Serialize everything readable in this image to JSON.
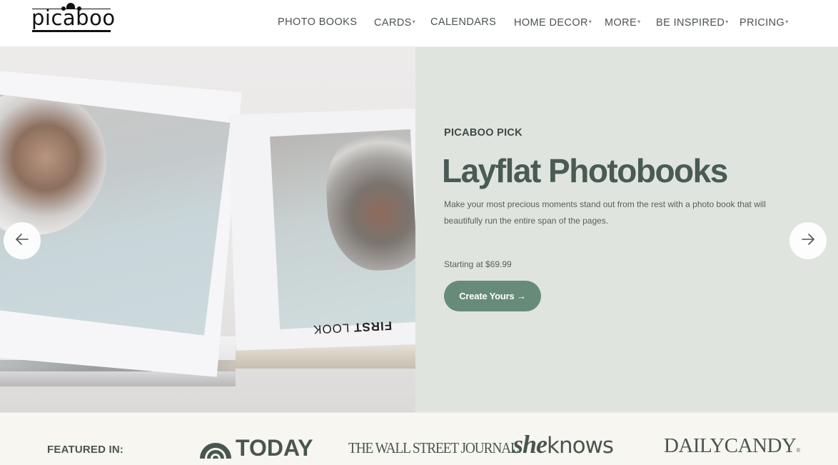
{
  "header": {
    "logo_text": "picaboo",
    "nav": [
      {
        "label": "PHOTO BOOKS",
        "has_dropdown": false
      },
      {
        "label": "CARDS",
        "has_dropdown": true
      },
      {
        "label": "CALENDARS",
        "has_dropdown": false
      },
      {
        "label": "HOME DECOR",
        "has_dropdown": true
      },
      {
        "label": "MORE",
        "has_dropdown": true
      },
      {
        "label": "BE INSPIRED",
        "has_dropdown": true
      },
      {
        "label": "PRICING",
        "has_dropdown": true
      }
    ],
    "caret_glyph": "▾"
  },
  "hero": {
    "image_caption_text_bold": "FIRST",
    "image_caption_text": " LOOK",
    "eyebrow": "PICABOO PICK",
    "title": "Layflat Photobooks",
    "description": "Make your most precious moments stand out from the rest with a photo book that will beautifully run the entire span of the pages.",
    "price": "Starting at $69.99",
    "cta_label": "Create Yours →",
    "prev_icon": "arrow-left-icon",
    "next_icon": "arrow-right-icon",
    "colors": {
      "panel_bg": "#dfe4de",
      "headline": "#4a5a54",
      "cta_bg": "#678b79"
    }
  },
  "featured": {
    "label": "FEATURED IN:",
    "logos": {
      "today": "TODAY",
      "wsj": "THE WALL STREET JOURNAL.",
      "sheknows_she": "she",
      "sheknows_knows": "knows",
      "dailycandy": "DAILYCANDY",
      "dailycandy_mark": "®"
    },
    "colors": {
      "bar_bg": "#f8f6f0",
      "logo_color": "#48564f"
    }
  }
}
